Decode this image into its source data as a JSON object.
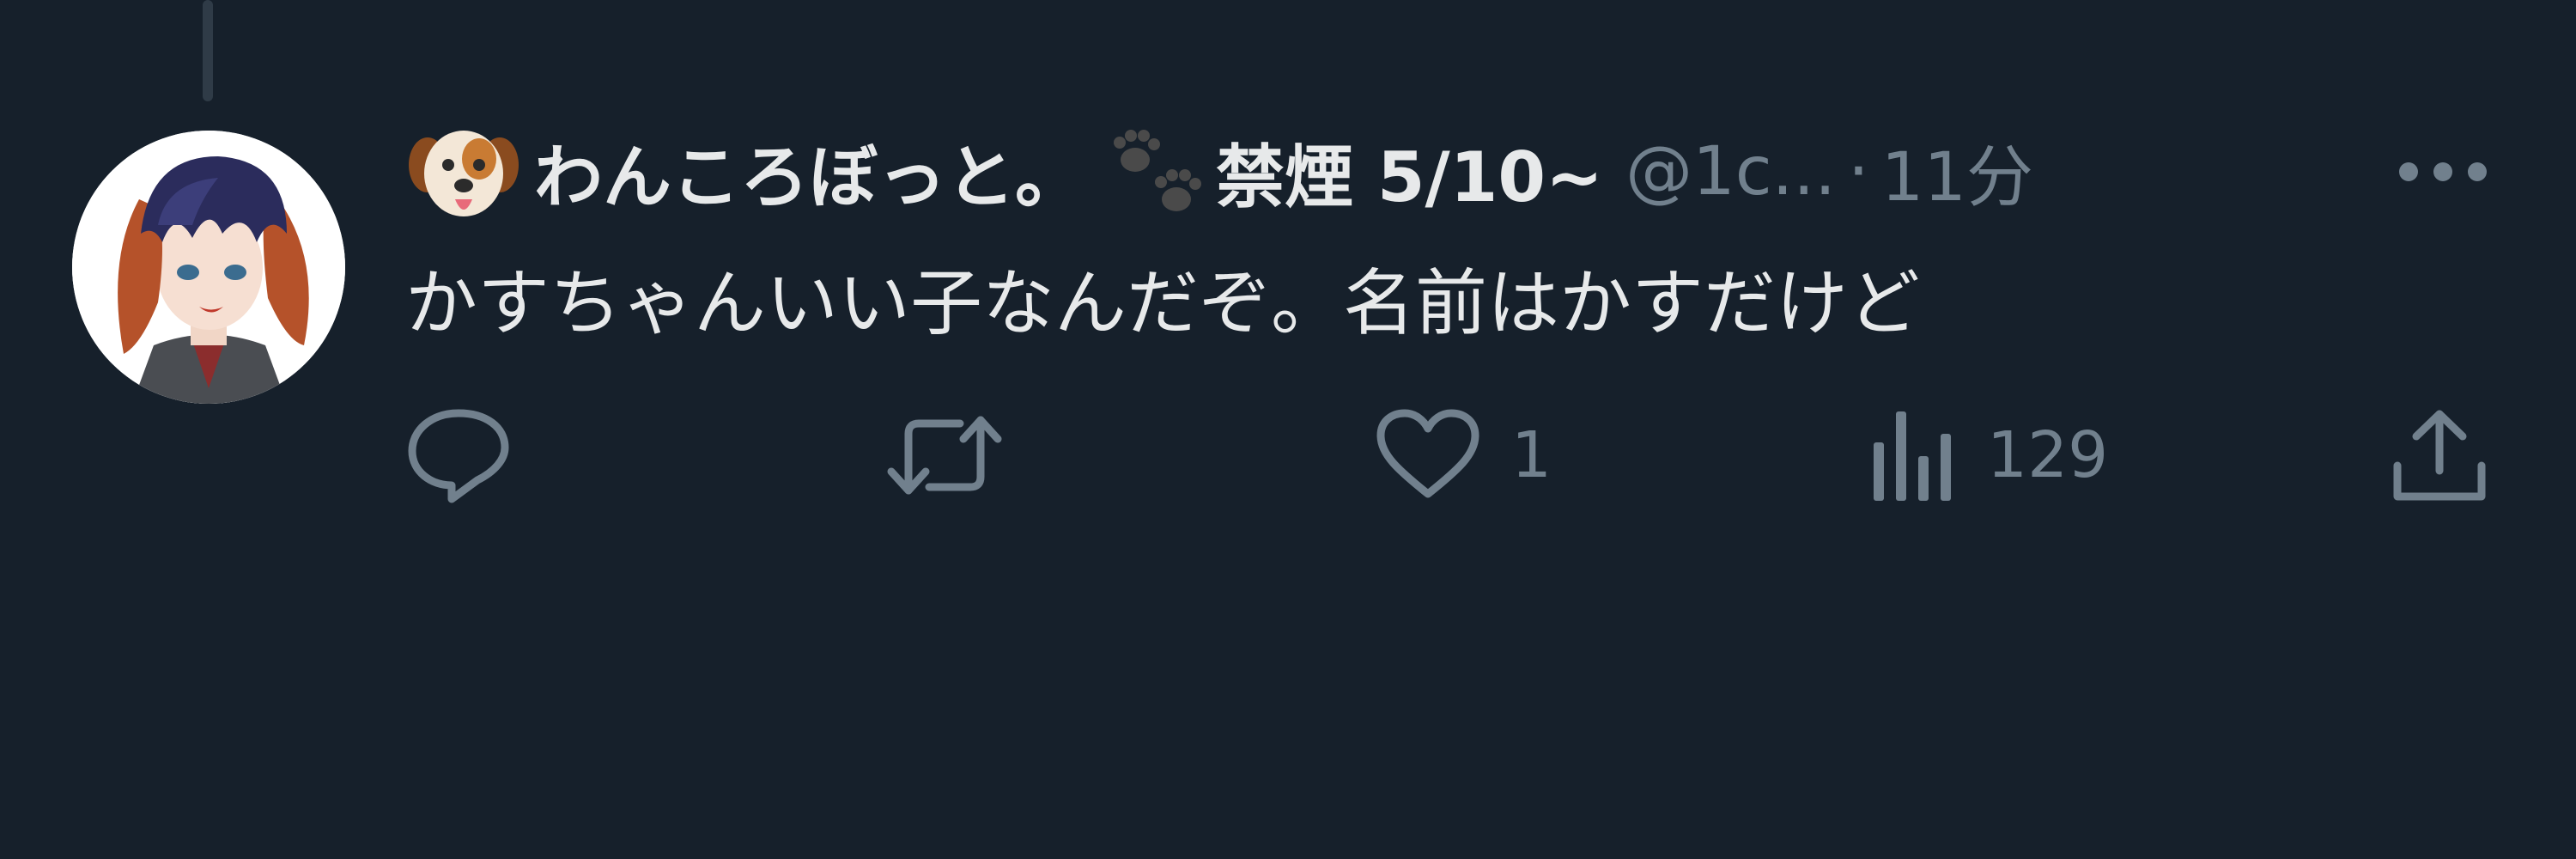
{
  "tweet": {
    "display_name": "わんころぼっと。",
    "display_name_suffix": "禁煙 5/10~",
    "name_emojis": [
      "dog-face-icon",
      "paw-prints-icon"
    ],
    "handle": "@1c...",
    "separator": "·",
    "timestamp": "11分",
    "text": "かすちゃんいい子なんだぞ。名前はかすだけど"
  },
  "actions": {
    "reply_count": "",
    "retweet_count": "",
    "like_count": "1",
    "views_count": "129"
  },
  "colors": {
    "background": "#16202b",
    "primary_text": "#e7e9ea",
    "secondary_text": "#71808d",
    "thread_line": "#2f3b47"
  }
}
